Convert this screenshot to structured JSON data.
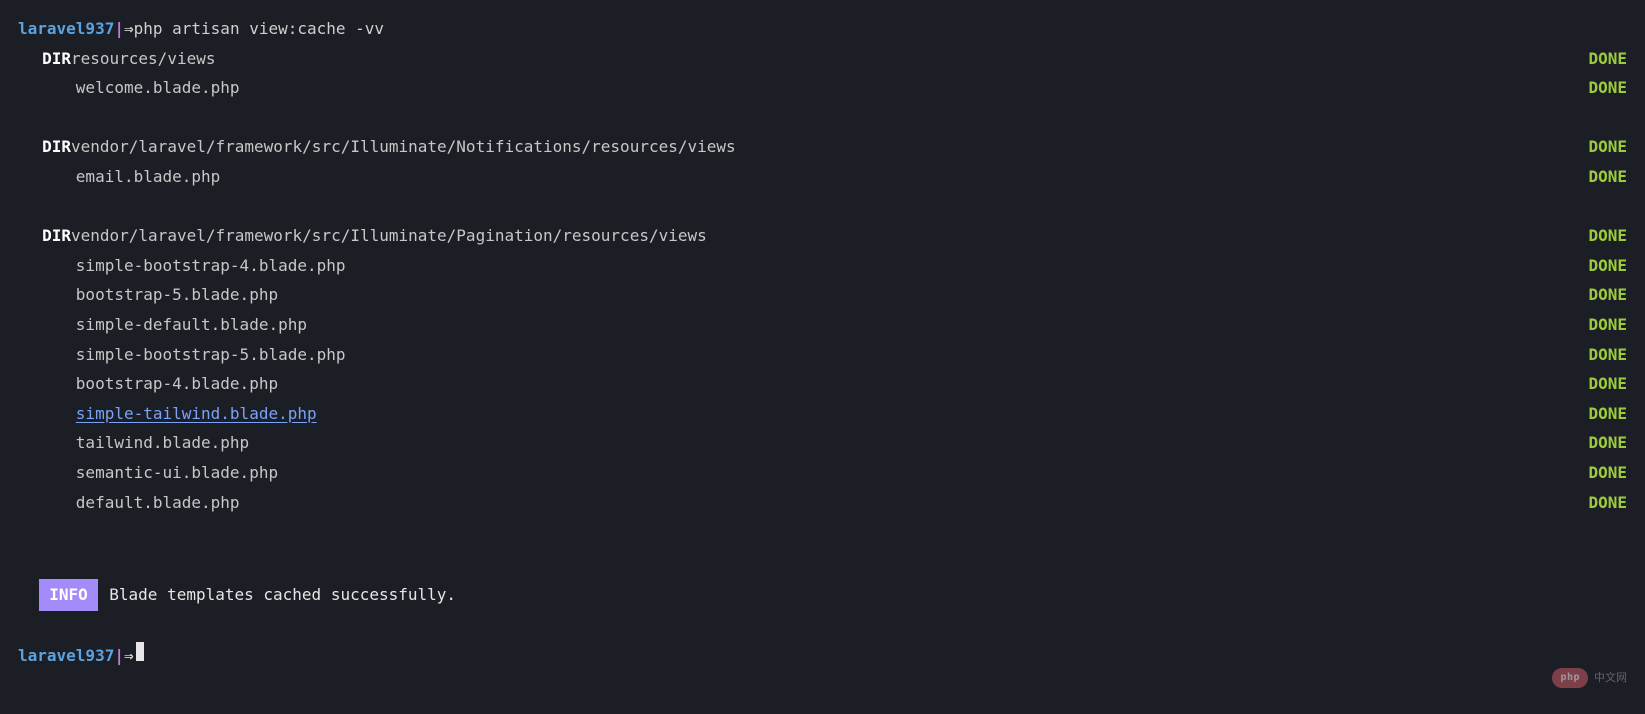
{
  "prompt": {
    "host": "laravel937",
    "sep": "|",
    "arrow": "⇒",
    "command": "php artisan view:cache -vv"
  },
  "labels": {
    "dir": "DIR",
    "done": "DONE",
    "info": "INFO"
  },
  "groups": [
    {
      "dir": "resources/views",
      "files": [
        {
          "name": "welcome.blade.php",
          "link": false
        }
      ]
    },
    {
      "dir": "vendor/laravel/framework/src/Illuminate/Notifications/resources/views",
      "files": [
        {
          "name": "email.blade.php",
          "link": false
        }
      ]
    },
    {
      "dir": "vendor/laravel/framework/src/Illuminate/Pagination/resources/views",
      "files": [
        {
          "name": "simple-bootstrap-4.blade.php",
          "link": false
        },
        {
          "name": "bootstrap-5.blade.php",
          "link": false
        },
        {
          "name": "simple-default.blade.php",
          "link": false
        },
        {
          "name": "simple-bootstrap-5.blade.php",
          "link": false
        },
        {
          "name": "bootstrap-4.blade.php",
          "link": false
        },
        {
          "name": "simple-tailwind.blade.php",
          "link": true
        },
        {
          "name": "tailwind.blade.php",
          "link": false
        },
        {
          "name": "semantic-ui.blade.php",
          "link": false
        },
        {
          "name": "default.blade.php",
          "link": false
        }
      ]
    }
  ],
  "info_message": "Blade templates cached successfully.",
  "watermark": {
    "pill": "php",
    "text": "中文网"
  }
}
